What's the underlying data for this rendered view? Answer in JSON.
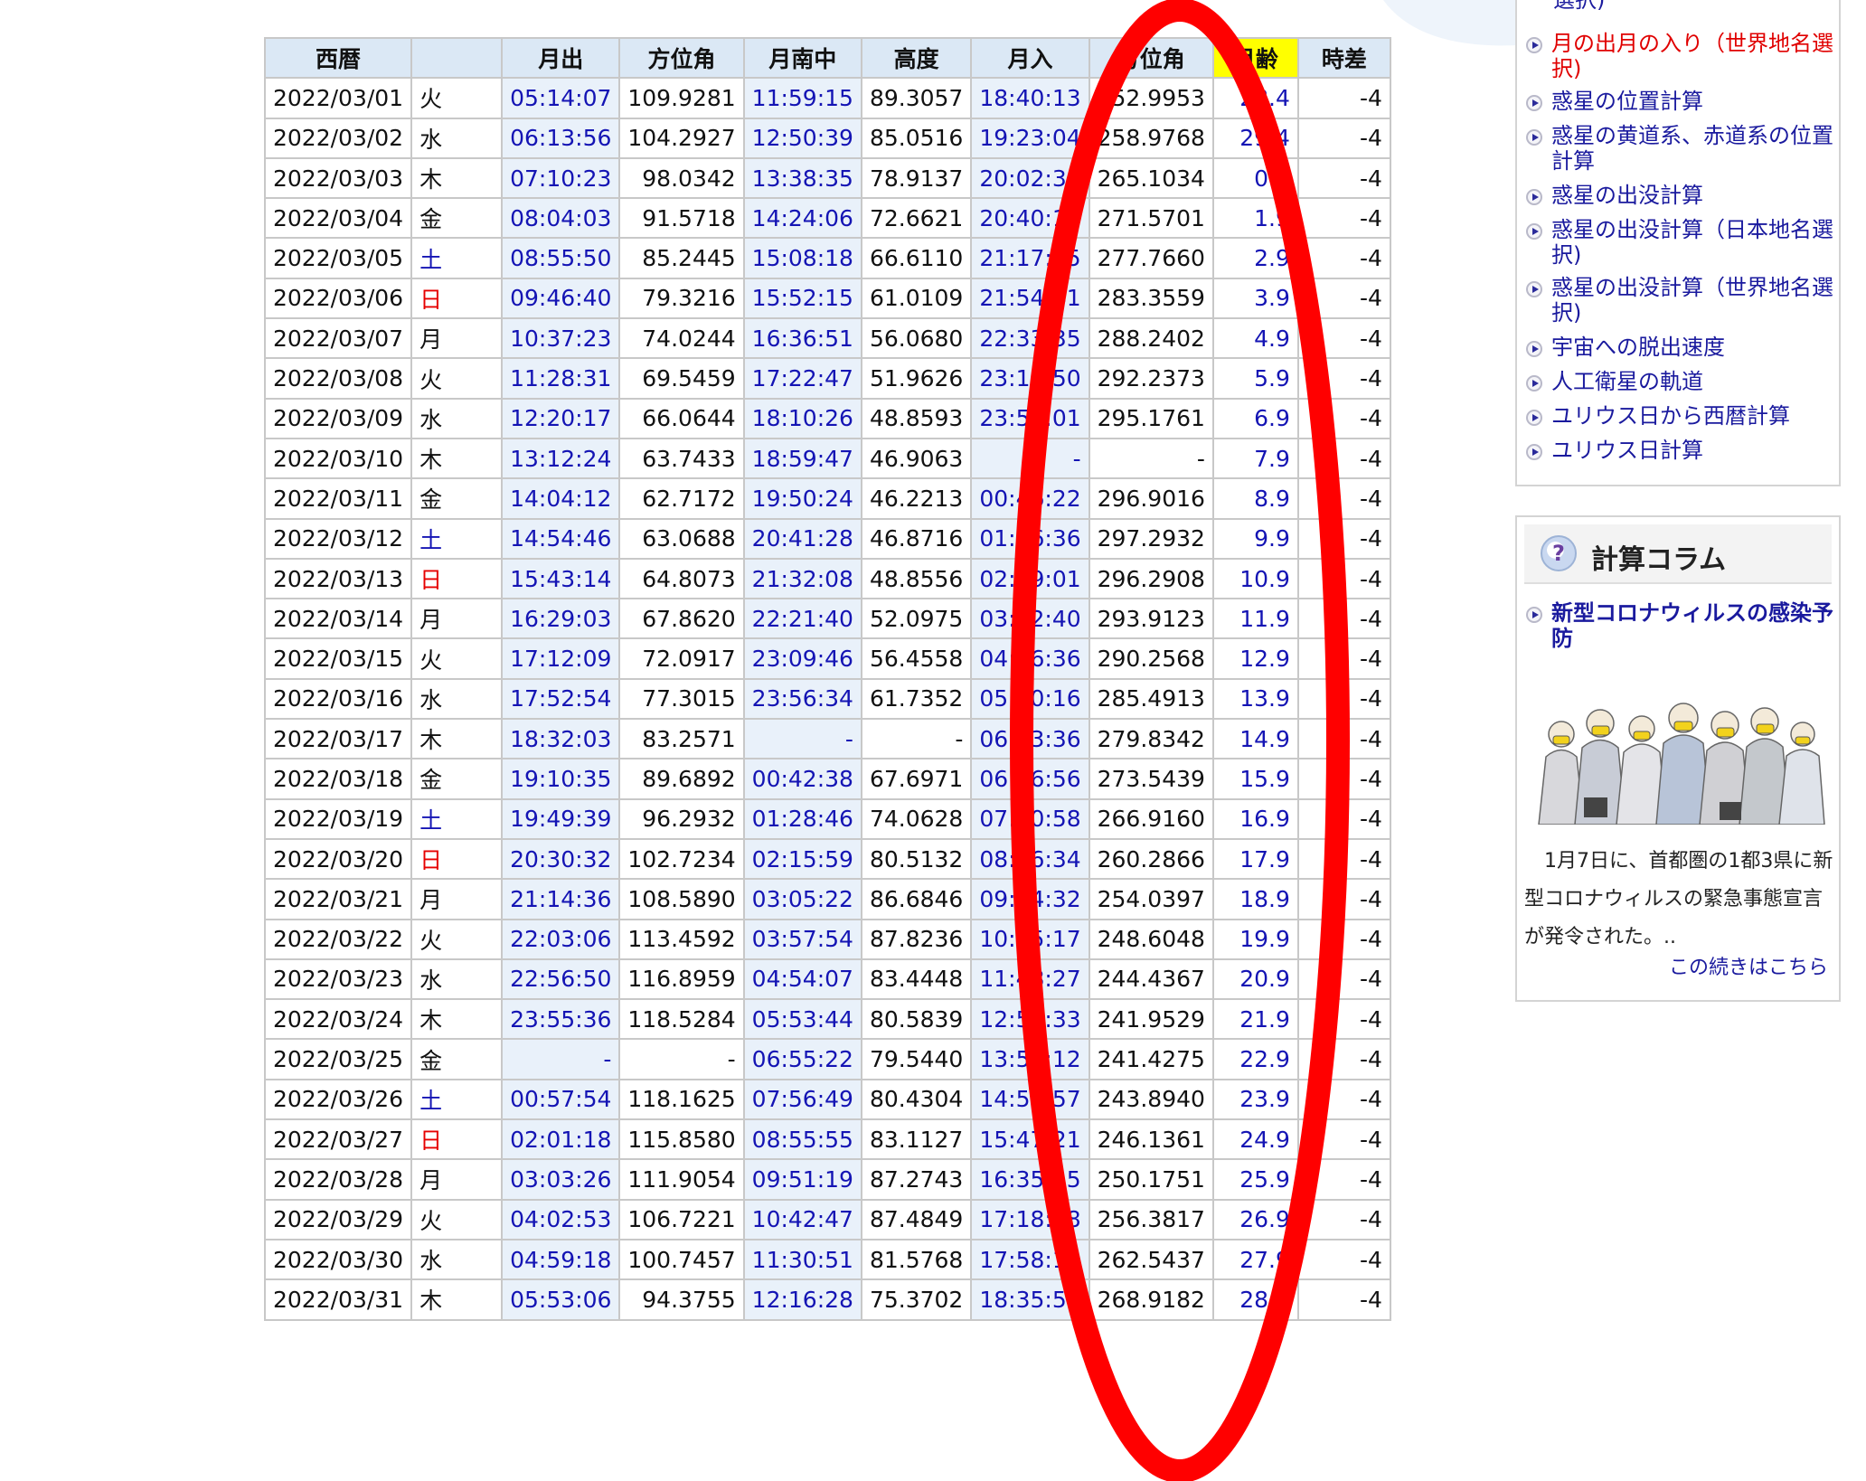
{
  "table": {
    "headers": [
      "西暦",
      "",
      "月出",
      "方位角",
      "月南中",
      "高度",
      "月入",
      "方位角",
      "月齢",
      "時差"
    ],
    "rows": [
      [
        "2022/03/01",
        "火",
        "05:14:07",
        "109.9281",
        "11:59:15",
        "89.3057",
        "18:40:13",
        "252.9953",
        "28.4",
        "-4"
      ],
      [
        "2022/03/02",
        "水",
        "06:13:56",
        "104.2927",
        "12:50:39",
        "85.0516",
        "19:23:04",
        "258.9768",
        "29.4",
        "-4"
      ],
      [
        "2022/03/03",
        "木",
        "07:10:23",
        "98.0342",
        "13:38:35",
        "78.9137",
        "20:02:39",
        "265.1034",
        "0.9",
        "-4"
      ],
      [
        "2022/03/04",
        "金",
        "08:04:03",
        "91.5718",
        "14:24:06",
        "72.6621",
        "20:40:17",
        "271.5701",
        "1.9",
        "-4"
      ],
      [
        "2022/03/05",
        "土",
        "08:55:50",
        "85.2445",
        "15:08:18",
        "66.6110",
        "21:17:15",
        "277.7660",
        "2.9",
        "-4"
      ],
      [
        "2022/03/06",
        "日",
        "09:46:40",
        "79.3216",
        "15:52:15",
        "61.0109",
        "21:54:41",
        "283.3559",
        "3.9",
        "-4"
      ],
      [
        "2022/03/07",
        "月",
        "10:37:23",
        "74.0244",
        "16:36:51",
        "56.0680",
        "22:33:35",
        "288.2402",
        "4.9",
        "-4"
      ],
      [
        "2022/03/08",
        "火",
        "11:28:31",
        "69.5459",
        "17:22:47",
        "51.9626",
        "23:14:50",
        "292.2373",
        "5.9",
        "-4"
      ],
      [
        "2022/03/09",
        "水",
        "12:20:17",
        "66.0644",
        "18:10:26",
        "48.8593",
        "23:59:01",
        "295.1761",
        "6.9",
        "-4"
      ],
      [
        "2022/03/10",
        "木",
        "13:12:24",
        "63.7433",
        "18:59:47",
        "46.9063",
        "-",
        "-",
        "7.9",
        "-4"
      ],
      [
        "2022/03/11",
        "金",
        "14:04:12",
        "62.7172",
        "19:50:24",
        "46.2213",
        "00:46:22",
        "296.9016",
        "8.9",
        "-4"
      ],
      [
        "2022/03/12",
        "土",
        "14:54:46",
        "63.0688",
        "20:41:28",
        "46.8716",
        "01:36:36",
        "297.2932",
        "9.9",
        "-4"
      ],
      [
        "2022/03/13",
        "日",
        "15:43:14",
        "64.8073",
        "21:32:08",
        "48.8556",
        "02:29:01",
        "296.2908",
        "10.9",
        "-4"
      ],
      [
        "2022/03/14",
        "月",
        "16:29:03",
        "67.8620",
        "22:21:40",
        "52.0975",
        "03:22:40",
        "293.9123",
        "11.9",
        "-4"
      ],
      [
        "2022/03/15",
        "火",
        "17:12:09",
        "72.0917",
        "23:09:46",
        "56.4558",
        "04:16:36",
        "290.2568",
        "12.9",
        "-4"
      ],
      [
        "2022/03/16",
        "水",
        "17:52:54",
        "77.3015",
        "23:56:34",
        "61.7352",
        "05:10:16",
        "285.4913",
        "13.9",
        "-4"
      ],
      [
        "2022/03/17",
        "木",
        "18:32:03",
        "83.2571",
        "-",
        "-",
        "06:03:36",
        "279.8342",
        "14.9",
        "-4"
      ],
      [
        "2022/03/18",
        "金",
        "19:10:35",
        "89.6892",
        "00:42:38",
        "67.6971",
        "06:56:56",
        "273.5439",
        "15.9",
        "-4"
      ],
      [
        "2022/03/19",
        "土",
        "19:49:39",
        "96.2932",
        "01:28:46",
        "74.0628",
        "07:50:58",
        "266.9160",
        "16.9",
        "-4"
      ],
      [
        "2022/03/20",
        "日",
        "20:30:32",
        "102.7234",
        "02:15:59",
        "80.5132",
        "08:46:34",
        "260.2866",
        "17.9",
        "-4"
      ],
      [
        "2022/03/21",
        "月",
        "21:14:36",
        "108.5890",
        "03:05:22",
        "86.6846",
        "09:44:32",
        "254.0397",
        "18.9",
        "-4"
      ],
      [
        "2022/03/22",
        "火",
        "22:03:06",
        "113.4592",
        "03:57:54",
        "87.8236",
        "10:45:17",
        "248.6048",
        "19.9",
        "-4"
      ],
      [
        "2022/03/23",
        "水",
        "22:56:50",
        "116.8959",
        "04:54:07",
        "83.4448",
        "11:48:27",
        "244.4367",
        "20.9",
        "-4"
      ],
      [
        "2022/03/24",
        "木",
        "23:55:36",
        "118.5284",
        "05:53:44",
        "80.5839",
        "12:52:33",
        "241.9529",
        "21.9",
        "-4"
      ],
      [
        "2022/03/25",
        "金",
        "-",
        "-",
        "06:55:22",
        "79.5440",
        "13:55:12",
        "241.4275",
        "22.9",
        "-4"
      ],
      [
        "2022/03/26",
        "土",
        "00:57:54",
        "118.1625",
        "07:56:49",
        "80.4304",
        "14:53:57",
        "243.8940",
        "23.9",
        "-4"
      ],
      [
        "2022/03/27",
        "日",
        "02:01:18",
        "115.8580",
        "08:55:55",
        "83.1127",
        "15:47:21",
        "246.1361",
        "24.9",
        "-4"
      ],
      [
        "2022/03/28",
        "月",
        "03:03:26",
        "111.9054",
        "09:51:19",
        "87.2743",
        "16:35:15",
        "250.1751",
        "25.9",
        "-4"
      ],
      [
        "2022/03/29",
        "火",
        "04:02:53",
        "106.7221",
        "10:42:47",
        "87.4849",
        "17:18:28",
        "256.3817",
        "26.9",
        "-4"
      ],
      [
        "2022/03/30",
        "水",
        "04:59:18",
        "100.7457",
        "11:30:51",
        "81.5768",
        "17:58:14",
        "262.5437",
        "27.9",
        "-4"
      ],
      [
        "2022/03/31",
        "木",
        "05:53:06",
        "94.3755",
        "12:16:28",
        "75.3702",
        "18:35:54",
        "268.9182",
        "28.9",
        "-4"
      ]
    ]
  },
  "sidebar": {
    "items": [
      {
        "label": "選択)",
        "active": false
      },
      {
        "label": "月の出月の入り（世界地名選択)",
        "active": true
      },
      {
        "label": "惑星の位置計算",
        "active": false
      },
      {
        "label": "惑星の黄道系、赤道系の位置計算",
        "active": false
      },
      {
        "label": "惑星の出没計算",
        "active": false
      },
      {
        "label": "惑星の出没計算（日本地名選択)",
        "active": false
      },
      {
        "label": "惑星の出没計算（世界地名選択)",
        "active": false
      },
      {
        "label": "宇宙への脱出速度",
        "active": false
      },
      {
        "label": "人工衛星の軌道",
        "active": false
      },
      {
        "label": "ユリウス日から西暦計算",
        "active": false
      },
      {
        "label": "ユリウス日計算",
        "active": false
      }
    ]
  },
  "column": {
    "title": "計算コラム",
    "icon_glyph": "?",
    "link": "新型コロナウィルスの感染予防",
    "text": "　1月7日に、首都圏の1都3県に新型コロナウィルスの緊急事態宣言が発令された。..",
    "more": "この続きはこちら"
  },
  "colors": {
    "header_bg": "#dbe8f5",
    "highlight": "#ffff00",
    "link_blue": "#1414b4",
    "sunday_red": "#e60000",
    "annotation_red": "#ff0000"
  }
}
